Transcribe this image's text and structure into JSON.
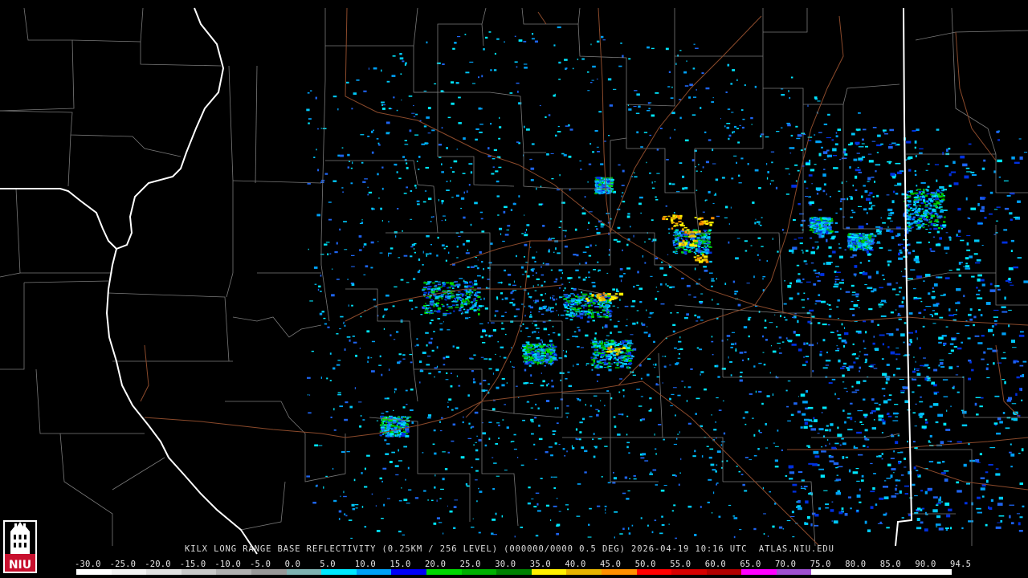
{
  "caption": {
    "text": "KILX LONG RANGE BASE REFLECTIVITY (0.25KM / 256 LEVEL) (000000/0000 0.5 DEG) 2026-04-19 10:16 UTC  ATLAS.NIU.EDU"
  },
  "legend": {
    "ticks": [
      "-30.0",
      "-25.0",
      "-20.0",
      "-15.0",
      "-10.0",
      "-5.0",
      "0.0",
      "5.0",
      "10.0",
      "15.0",
      "20.0",
      "25.0",
      "30.0",
      "35.0",
      "40.0",
      "45.0",
      "50.0",
      "55.0",
      "60.0",
      "65.0",
      "70.0",
      "75.0",
      "80.0",
      "85.0",
      "90.0",
      "94.5"
    ],
    "colors": [
      "#ffffff",
      "#f2f2f2",
      "#e0e0e0",
      "#c8c8c8",
      "#b0b0b0",
      "#989898",
      "#7fb2b2",
      "#00e8ff",
      "#00a0f6",
      "#0000f6",
      "#00d800",
      "#00b000",
      "#008000",
      "#fff000",
      "#e8b400",
      "#ff9000",
      "#ff0000",
      "#d60000",
      "#b00000",
      "#ff00ff",
      "#a050d0",
      "#ffffff",
      "#ffffff",
      "#ffffff",
      "#ffffff"
    ]
  },
  "logo": {
    "text": "NIU",
    "color": "#c8102e"
  },
  "map": {
    "background": "#000000",
    "county_line_color": "#7a7a7a",
    "state_line_color": "#ffffff",
    "road_color": "#8b4a2b",
    "radar_site": "KILX"
  }
}
